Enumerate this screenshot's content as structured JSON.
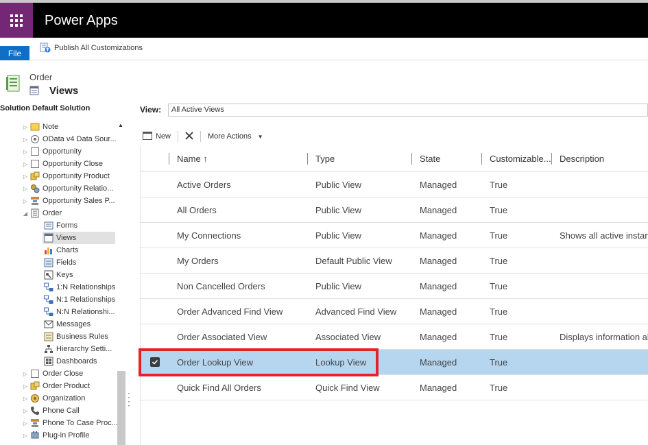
{
  "app": {
    "title": "Power Apps"
  },
  "command_bar": {
    "file_label": "File",
    "publish_label": "Publish All Customizations"
  },
  "entity": {
    "name": "Order",
    "page_title": "Views"
  },
  "solution": {
    "label": "Solution Default Solution"
  },
  "tree": {
    "items": [
      {
        "label": "Note",
        "icon": "note-icon"
      },
      {
        "label": "OData v4 Data Sour...",
        "icon": "odata-icon"
      },
      {
        "label": "Opportunity",
        "icon": "entity-icon"
      },
      {
        "label": "Opportunity Close",
        "icon": "entity-icon"
      },
      {
        "label": "Opportunity Product",
        "icon": "product-icon"
      },
      {
        "label": "Opportunity Relatio...",
        "icon": "relationship-entity-icon"
      },
      {
        "label": "Opportunity Sales P...",
        "icon": "sales-process-icon"
      },
      {
        "label": "Order",
        "icon": "order-icon"
      },
      {
        "label": "Forms",
        "icon": "forms-icon"
      },
      {
        "label": "Views",
        "icon": "views-icon"
      },
      {
        "label": "Charts",
        "icon": "charts-icon"
      },
      {
        "label": "Fields",
        "icon": "fields-icon"
      },
      {
        "label": "Keys",
        "icon": "keys-icon"
      },
      {
        "label": "1:N Relationships",
        "icon": "relationship-icon"
      },
      {
        "label": "N:1 Relationships",
        "icon": "relationship-icon"
      },
      {
        "label": "N:N Relationshi...",
        "icon": "relationship-icon"
      },
      {
        "label": "Messages",
        "icon": "messages-icon"
      },
      {
        "label": "Business Rules",
        "icon": "business-rules-icon"
      },
      {
        "label": "Hierarchy Setti...",
        "icon": "hierarchy-icon"
      },
      {
        "label": "Dashboards",
        "icon": "dashboards-icon"
      },
      {
        "label": "Order Close",
        "icon": "entity-icon"
      },
      {
        "label": "Order Product",
        "icon": "product-icon"
      },
      {
        "label": "Organization",
        "icon": "organization-icon"
      },
      {
        "label": "Phone Call",
        "icon": "phone-icon"
      },
      {
        "label": "Phone To Case Proc...",
        "icon": "sales-process-icon"
      },
      {
        "label": "Plug-in Profile",
        "icon": "plugin-icon"
      }
    ]
  },
  "view_selector": {
    "label": "View:",
    "value": "All Active Views"
  },
  "toolbar": {
    "new_label": "New",
    "more_actions_label": "More Actions"
  },
  "grid": {
    "columns": [
      "Name ↑",
      "Type",
      "State",
      "Customizable...",
      "Description"
    ],
    "rows": [
      {
        "name": "Active Orders",
        "type": "Public View",
        "state": "Managed",
        "customizable": "True",
        "description": ""
      },
      {
        "name": "All Orders",
        "type": "Public View",
        "state": "Managed",
        "customizable": "True",
        "description": ""
      },
      {
        "name": "My Connections",
        "type": "Public View",
        "state": "Managed",
        "customizable": "True",
        "description": "Shows all active instanc"
      },
      {
        "name": "My Orders",
        "type": "Default Public View",
        "state": "Managed",
        "customizable": "True",
        "description": ""
      },
      {
        "name": "Non Cancelled Orders",
        "type": "Public View",
        "state": "Managed",
        "customizable": "True",
        "description": ""
      },
      {
        "name": "Order Advanced Find View",
        "type": "Advanced Find View",
        "state": "Managed",
        "customizable": "True",
        "description": ""
      },
      {
        "name": "Order Associated View",
        "type": "Associated View",
        "state": "Managed",
        "customizable": "True",
        "description": "Displays information ab"
      },
      {
        "name": "Order Lookup View",
        "type": "Lookup View",
        "state": "Managed",
        "customizable": "True",
        "description": ""
      },
      {
        "name": "Quick Find All Orders",
        "type": "Quick Find View",
        "state": "Managed",
        "customizable": "True",
        "description": ""
      }
    ],
    "selected_row": 7
  },
  "colors": {
    "brand": "#742774",
    "file_button": "#0f6fc6",
    "selected_row": "#b6d6ef",
    "highlight": "#e3232b"
  }
}
